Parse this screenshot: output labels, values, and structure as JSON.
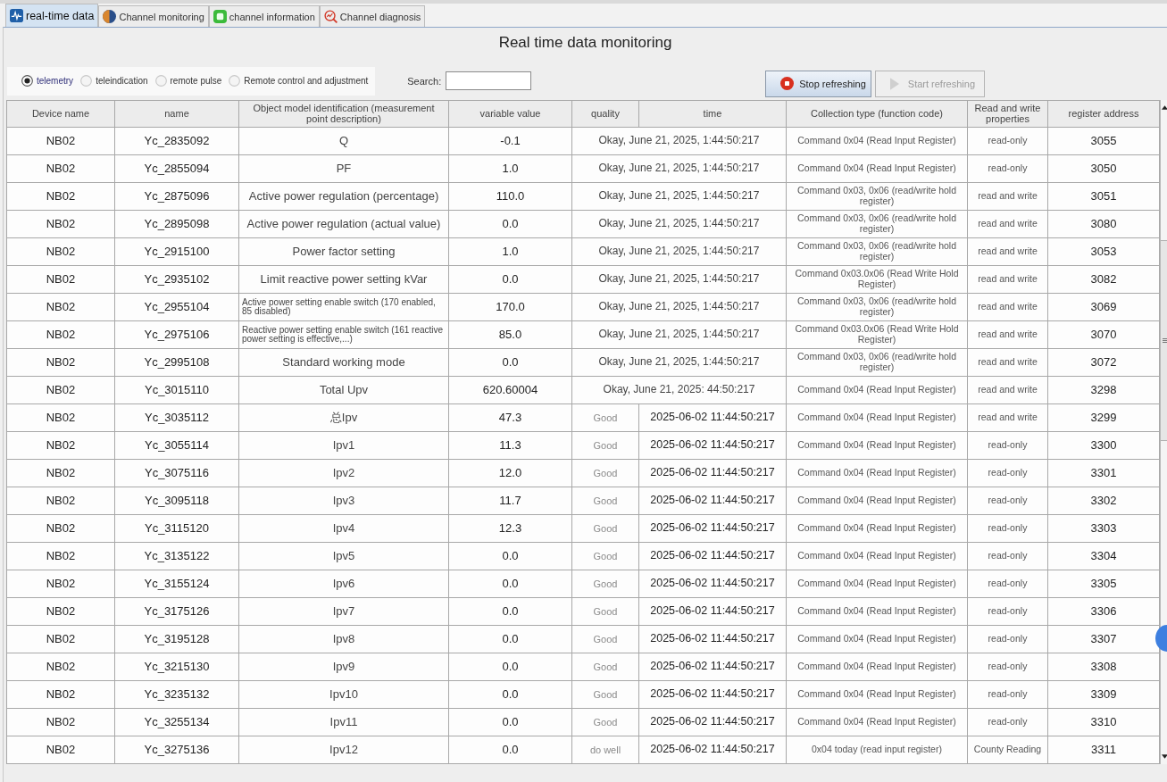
{
  "tabs": [
    {
      "label": "real-time data",
      "selected": true
    },
    {
      "label": "Channel monitoring",
      "selected": false
    },
    {
      "label": "channel information",
      "selected": false
    },
    {
      "label": "Channel diagnosis",
      "selected": false
    }
  ],
  "title": "Real time data monitoring",
  "filters": [
    {
      "label": "telemetry",
      "selected": true
    },
    {
      "label": "teleindication",
      "selected": false
    },
    {
      "label": "remote pulse",
      "selected": false
    },
    {
      "label": "Remote control and adjustment",
      "selected": false
    }
  ],
  "search": {
    "label": "Search:"
  },
  "buttons": [
    {
      "label": "Stop refreshing",
      "disabled": false
    },
    {
      "label": "Start refreshing",
      "disabled": true
    }
  ],
  "table": {
    "columns": [
      "Device name",
      "name",
      "Object model identification (measurement point description)",
      "variable value",
      "quality",
      "time",
      "Collection type (function code)",
      "Read and write properties",
      "register address"
    ],
    "rows": [
      {
        "device_name": "NB02",
        "name": "Yc_2835092",
        "description": "Q",
        "value": "-0.1",
        "quality_and_time": "Okay, June 21, 2025, 1:44:50:217",
        "collection_type": "Command 0x04 (Read Input Register)",
        "access": "read-only",
        "register_address": "3055"
      },
      {
        "device_name": "NB02",
        "name": "Yc_2855094",
        "description": "PF",
        "value": "1.0",
        "quality_and_time": "Okay, June 21, 2025, 1:44:50:217",
        "collection_type": "Command 0x04 (Read Input Register)",
        "access": "read-only",
        "register_address": "3050"
      },
      {
        "device_name": "NB02",
        "name": "Yc_2875096",
        "description": "Active power regulation (percentage)",
        "value": "110.0",
        "quality_and_time": "Okay, June 21, 2025, 1:44:50:217",
        "collection_type": "Command 0x03, 0x06 (read/write hold register)",
        "access": "read and write",
        "register_address": "3051"
      },
      {
        "device_name": "NB02",
        "name": "Yc_2895098",
        "description": "Active power regulation (actual value)",
        "value": "0.0",
        "quality_and_time": "Okay, June 21, 2025, 1:44:50:217",
        "collection_type": "Command 0x03, 0x06 (read/write hold register)",
        "access": "read and write",
        "register_address": "3080"
      },
      {
        "device_name": "NB02",
        "name": "Yc_2915100",
        "description": "Power factor setting",
        "value": "1.0",
        "quality_and_time": "Okay, June 21, 2025, 1:44:50:217",
        "collection_type": "Command 0x03, 0x06 (read/write hold register)",
        "access": "read and write",
        "register_address": "3053"
      },
      {
        "device_name": "NB02",
        "name": "Yc_2935102",
        "description": "Limit reactive power setting kVar",
        "value": "0.0",
        "quality_and_time": "Okay, June 21, 2025, 1:44:50:217",
        "collection_type": "Command 0x03.0x06 (Read Write Hold Register)",
        "access": "read and write",
        "register_address": "3082"
      },
      {
        "device_name": "NB02",
        "name": "Yc_2955104",
        "description": "Active power setting enable switch (170 enabled, 85 disabled)",
        "value": "170.0",
        "quality_and_time": "Okay, June 21, 2025, 1:44:50:217",
        "collection_type": "Command 0x03, 0x06 (read/write hold register)",
        "access": "read and write",
        "register_address": "3069"
      },
      {
        "device_name": "NB02",
        "name": "Yc_2975106",
        "description": "Reactive power setting enable switch (161 reactive power setting is effective,...)",
        "value": "85.0",
        "quality_and_time": "Okay, June 21, 2025, 1:44:50:217",
        "collection_type": "Command 0x03.0x06 (Read Write Hold Register)",
        "access": "read and write",
        "register_address": "3070"
      },
      {
        "device_name": "NB02",
        "name": "Yc_2995108",
        "description": "Standard working mode",
        "value": "0.0",
        "quality_and_time": "Okay, June 21, 2025, 1:44:50:217",
        "collection_type": "Command 0x03, 0x06 (read/write hold register)",
        "access": "read and write",
        "register_address": "3072"
      },
      {
        "device_name": "NB02",
        "name": "Yc_3015110",
        "description": "Total Upv",
        "value": "620.60004",
        "quality_and_time": "Okay, June 21, 2025: 44:50:217",
        "collection_type": "Command 0x04 (Read Input Register)",
        "access": "read and write",
        "register_address": "3298"
      },
      {
        "device_name": "NB02",
        "name": "Yc_3035112",
        "description": "总Ipv",
        "value": "47.3",
        "quality": "Good",
        "time": "2025-06-02 11:44:50:217",
        "collection_type": "Command 0x04 (Read Input Register)",
        "access": "read and write",
        "register_address": "3299"
      },
      {
        "device_name": "NB02",
        "name": "Yc_3055114",
        "description": "Ipv1",
        "value": "11.3",
        "quality": "Good",
        "time": "2025-06-02 11:44:50:217",
        "collection_type": "Command 0x04 (Read Input Register)",
        "access": "read-only",
        "register_address": "3300"
      },
      {
        "device_name": "NB02",
        "name": "Yc_3075116",
        "description": "Ipv2",
        "value": "12.0",
        "quality": "Good",
        "time": "2025-06-02 11:44:50:217",
        "collection_type": "Command 0x04 (Read Input Register)",
        "access": "read-only",
        "register_address": "3301"
      },
      {
        "device_name": "NB02",
        "name": "Yc_3095118",
        "description": "Ipv3",
        "value": "11.7",
        "quality": "Good",
        "time": "2025-06-02 11:44:50:217",
        "collection_type": "Command 0x04 (Read Input Register)",
        "access": "read-only",
        "register_address": "3302"
      },
      {
        "device_name": "NB02",
        "name": "Yc_3115120",
        "description": "Ipv4",
        "value": "12.3",
        "quality": "Good",
        "time": "2025-06-02 11:44:50:217",
        "collection_type": "Command 0x04 (Read Input Register)",
        "access": "read-only",
        "register_address": "3303"
      },
      {
        "device_name": "NB02",
        "name": "Yc_3135122",
        "description": "Ipv5",
        "value": "0.0",
        "quality": "Good",
        "time": "2025-06-02 11:44:50:217",
        "collection_type": "Command 0x04 (Read Input Register)",
        "access": "read-only",
        "register_address": "3304"
      },
      {
        "device_name": "NB02",
        "name": "Yc_3155124",
        "description": "Ipv6",
        "value": "0.0",
        "quality": "Good",
        "time": "2025-06-02 11:44:50:217",
        "collection_type": "Command 0x04 (Read Input Register)",
        "access": "read-only",
        "register_address": "3305"
      },
      {
        "device_name": "NB02",
        "name": "Yc_3175126",
        "description": "Ipv7",
        "value": "0.0",
        "quality": "Good",
        "time": "2025-06-02 11:44:50:217",
        "collection_type": "Command 0x04 (Read Input Register)",
        "access": "read-only",
        "register_address": "3306"
      },
      {
        "device_name": "NB02",
        "name": "Yc_3195128",
        "description": "Ipv8",
        "value": "0.0",
        "quality": "Good",
        "time": "2025-06-02 11:44:50:217",
        "collection_type": "Command 0x04 (Read Input Register)",
        "access": "read-only",
        "register_address": "3307"
      },
      {
        "device_name": "NB02",
        "name": "Yc_3215130",
        "description": "Ipv9",
        "value": "0.0",
        "quality": "Good",
        "time": "2025-06-02 11:44:50:217",
        "collection_type": "Command 0x04 (Read Input Register)",
        "access": "read-only",
        "register_address": "3308"
      },
      {
        "device_name": "NB02",
        "name": "Yc_3235132",
        "description": "Ipv10",
        "value": "0.0",
        "quality": "Good",
        "time": "2025-06-02 11:44:50:217",
        "collection_type": "Command 0x04 (Read Input Register)",
        "access": "read-only",
        "register_address": "3309"
      },
      {
        "device_name": "NB02",
        "name": "Yc_3255134",
        "description": "Ipv11",
        "value": "0.0",
        "quality": "Good",
        "time": "2025-06-02 11:44:50:217",
        "collection_type": "Command 0x04 (Read Input Register)",
        "access": "read-only",
        "register_address": "3310"
      },
      {
        "device_name": "NB02",
        "name": "Yc_3275136",
        "description": "Ipv12",
        "value": "0.0",
        "quality": "do well",
        "time": "2025-06-02 11:44:50:217",
        "collection_type": "0x04 today (read input register)",
        "access": "County Reading",
        "register_address": "3311"
      }
    ]
  }
}
